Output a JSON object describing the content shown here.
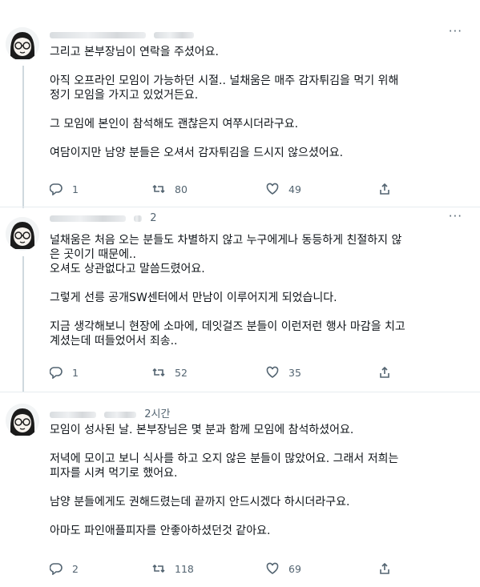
{
  "tweets": [
    {
      "time": "",
      "more": "···",
      "lines": [
        "그리고 본부장님이 연락을 주셨어요.",
        "",
        "아직 오프라인 모임이 가능하던 시절.. 널채움은 매주 감자튀김을 먹기 위해",
        "정기 모임을 가지고 있었거든요.",
        "",
        "그 모임에 본인이 참석해도 괜찮은지 여쭈시더라구요.",
        "",
        "여담이지만 남양 분들은 오셔서 감자튀김을 드시지 않으셨어요."
      ],
      "replies": "1",
      "retweets": "80",
      "likes": "49"
    },
    {
      "time": "2",
      "more": "···",
      "lines": [
        "널채움은 처음 오는 분들도 차별하지 않고 누구에게나 동등하게 친절하지 않",
        "은 곳이기 때문에..",
        "오셔도 상관없다고 말씀드렸어요.",
        "",
        "그렇게 선릉 공개SW센터에서 만남이 이루어지게 되었습니다.",
        "",
        "지금 생각해보니 현장에 소마에, 데잇걸즈 분들이 이런저런 행사 마감을 치고",
        "계셨는데 떠들었어서 죄송.."
      ],
      "replies": "1",
      "retweets": "52",
      "likes": "35"
    },
    {
      "time": "2시간",
      "more": "",
      "lines": [
        "모임이 성사된 날. 본부장님은 몇 분과 함께 모임에 참석하셨어요.",
        "",
        "저녁에 모이고 보니 식사를 하고 오지 않은 분들이 많았어요. 그래서 저희는",
        "피자를 시켜 먹기로 했어요.",
        "",
        "남양 분들에게도 권해드렸는데 끝까지 안드시겠다 하시더라구요.",
        "",
        "아마도 파인애플피자를 안좋아하셨던것 같아요."
      ],
      "replies": "2",
      "retweets": "118",
      "likes": "69"
    }
  ]
}
